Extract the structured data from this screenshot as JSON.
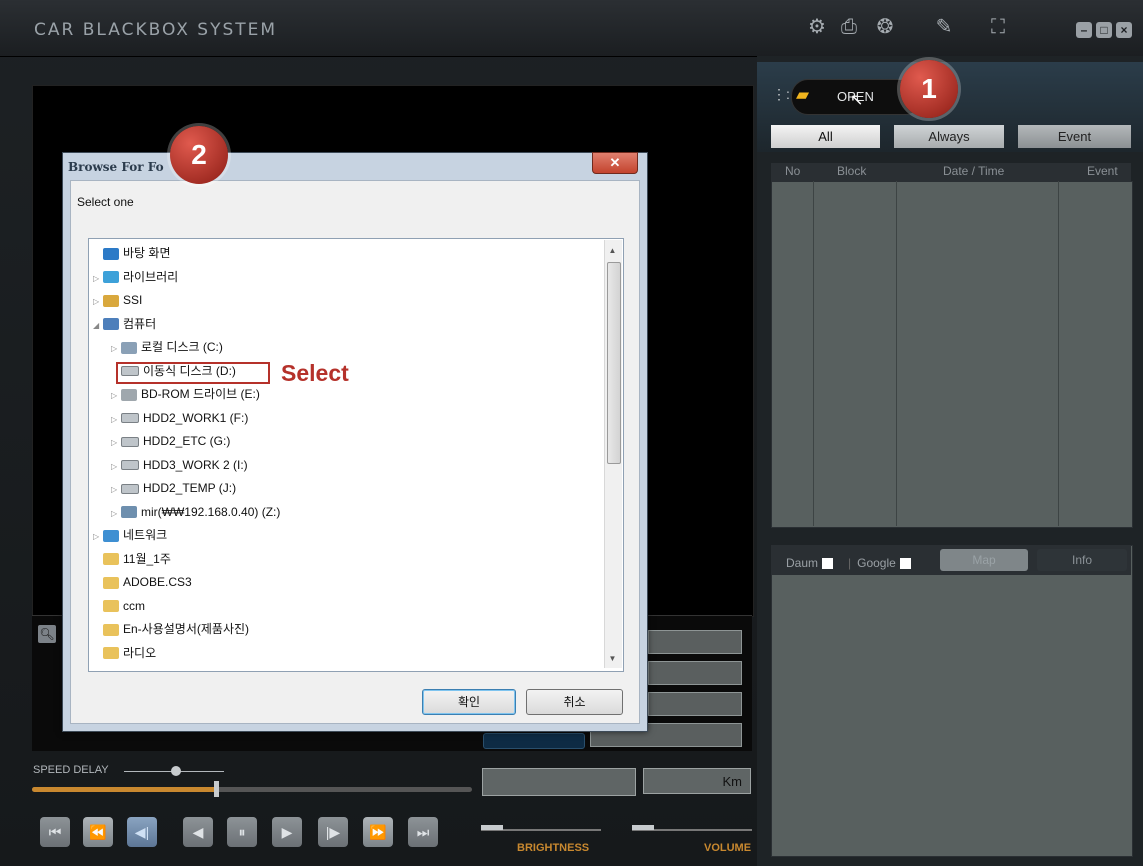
{
  "app": {
    "title": "CAR BLACKBOX SYSTEM"
  },
  "toolbar": {
    "icons": [
      "gear-icon",
      "printer-icon",
      "film-reel-icon",
      "edit-icon",
      "fullscreen-icon"
    ]
  },
  "window_buttons": [
    "minimize",
    "maximize",
    "close"
  ],
  "open_button": {
    "label": "OPEN"
  },
  "filter_tabs": [
    {
      "label": "All"
    },
    {
      "label": "Always"
    },
    {
      "label": "Event"
    }
  ],
  "list_header": {
    "no": "No",
    "block": "Block",
    "datetime": "Date / Time",
    "event": "Event"
  },
  "info_panel": {
    "daum": "Daum",
    "google": "Google",
    "map": "Map",
    "info": "Info"
  },
  "controls": {
    "speed_delay": "SPEED DELAY",
    "km_unit": "Km",
    "brightness": "BRIGHTNESS",
    "volume": "VOLUME"
  },
  "dialog": {
    "title": "Browse For Fo",
    "prompt": "Select one",
    "ok": "확인",
    "cancel": "취소",
    "tree": [
      {
        "label": "바탕 화면",
        "icon": "desktop-icon",
        "depth": 0,
        "arrow": ""
      },
      {
        "label": "라이브러리",
        "icon": "library-icon",
        "depth": 0,
        "arrow": "▷"
      },
      {
        "label": "SSI",
        "icon": "user-icon",
        "depth": 0,
        "arrow": "▷"
      },
      {
        "label": "컴퓨터",
        "icon": "computer-icon",
        "depth": 0,
        "arrow": "◢"
      },
      {
        "label": "로컬 디스크 (C:)",
        "icon": "system-drive-icon",
        "depth": 1,
        "arrow": "▷"
      },
      {
        "label": "이동식 디스크 (D:)",
        "icon": "drive-icon",
        "depth": 1,
        "arrow": ""
      },
      {
        "label": "BD-ROM 드라이브 (E:)",
        "icon": "disc-drive-icon",
        "depth": 1,
        "arrow": "▷"
      },
      {
        "label": "HDD2_WORK1 (F:)",
        "icon": "drive-icon",
        "depth": 1,
        "arrow": "▷"
      },
      {
        "label": "HDD2_ETC (G:)",
        "icon": "drive-icon",
        "depth": 1,
        "arrow": "▷"
      },
      {
        "label": "HDD3_WORK 2 (I:)",
        "icon": "drive-icon",
        "depth": 1,
        "arrow": "▷"
      },
      {
        "label": "HDD2_TEMP (J:)",
        "icon": "drive-icon",
        "depth": 1,
        "arrow": "▷"
      },
      {
        "label": "mir(₩₩192.168.0.40) (Z:)",
        "icon": "network-drive-icon",
        "depth": 1,
        "arrow": "▷"
      },
      {
        "label": "네트워크",
        "icon": "network-icon",
        "depth": 0,
        "arrow": "▷"
      },
      {
        "label": "11월_1주",
        "icon": "folder-icon",
        "depth": 0,
        "arrow": ""
      },
      {
        "label": "ADOBE.CS3",
        "icon": "folder-icon",
        "depth": 0,
        "arrow": ""
      },
      {
        "label": "ccm",
        "icon": "folder-icon",
        "depth": 0,
        "arrow": ""
      },
      {
        "label": "En-사용설명서(제품사진)",
        "icon": "folder-icon",
        "depth": 0,
        "arrow": ""
      },
      {
        "label": "라디오",
        "icon": "folder-icon",
        "depth": 0,
        "arrow": ""
      }
    ]
  },
  "annotations": {
    "step1": "1",
    "step2": "2",
    "select_label": "Select"
  },
  "colors": {
    "accent_orange": "#c8882f",
    "badge_red": "#b5312a",
    "panel_gray": "#58605f"
  }
}
